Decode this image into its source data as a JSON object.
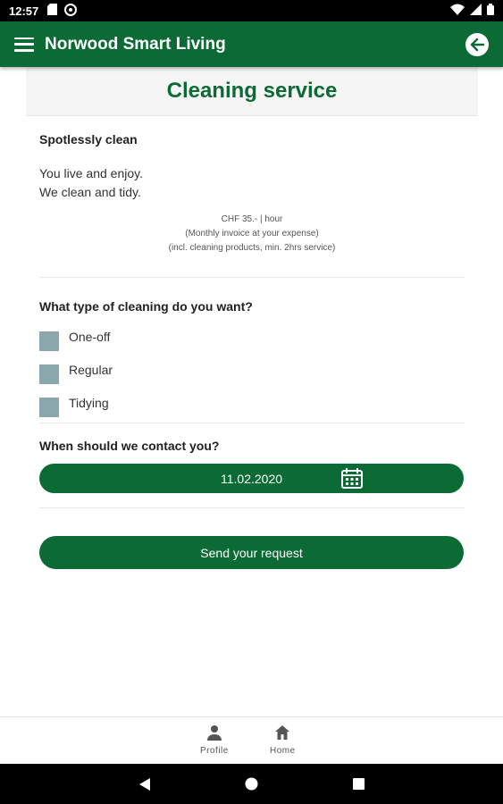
{
  "status_bar": {
    "time": "12:57"
  },
  "app_bar": {
    "title": "Norwood Smart Living",
    "menu_icon": "menu-icon",
    "back_icon": "arrow-back-icon"
  },
  "header": {
    "title": "Cleaning service"
  },
  "intro": {
    "heading": "Spotlessly clean",
    "line1": "You live and enjoy.",
    "line2": "We clean and tidy.",
    "price_line1": "CHF 35.- | hour",
    "price_line2": "(Monthly invoice at your expense)",
    "price_line3": "(incl. cleaning products, min. 2hrs service)"
  },
  "cleaning_type": {
    "question": "What type of cleaning do you want?",
    "options": [
      "One-off",
      "Regular",
      "Tidying"
    ]
  },
  "contact": {
    "question": "When should we contact you?",
    "date": "11.02.2020"
  },
  "submit": {
    "label": "Send your request"
  },
  "bottom_nav": {
    "profile": "Profile",
    "home": "Home"
  },
  "colors": {
    "primary": "#0c6b35",
    "checkbox": "#8aa7ad",
    "header_bg": "#f5f5f5"
  }
}
